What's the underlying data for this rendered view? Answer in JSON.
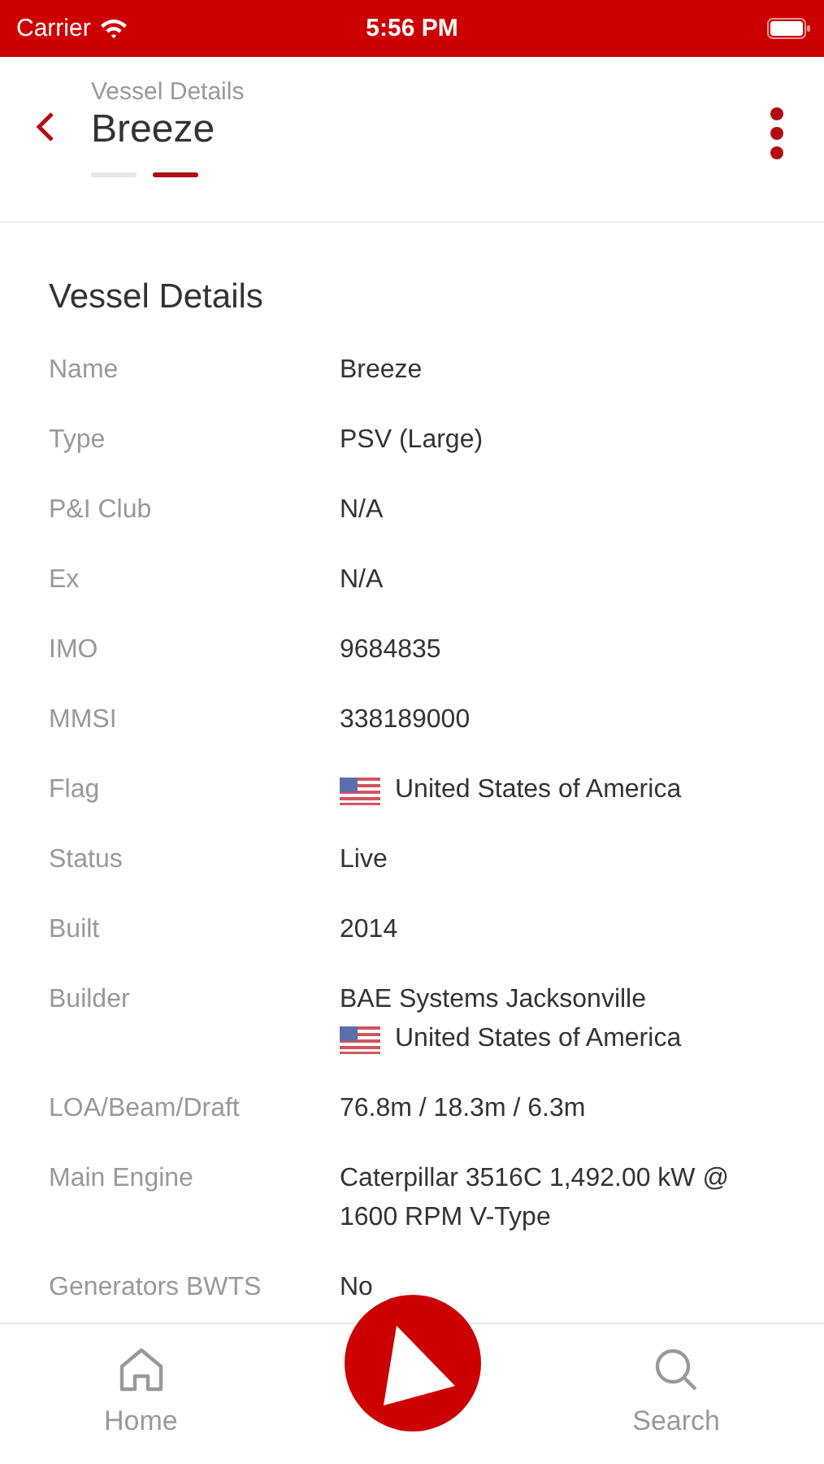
{
  "status_bar": {
    "carrier": "Carrier",
    "time": "5:56 PM"
  },
  "header": {
    "subtitle": "Vessel Details",
    "title": "Breeze",
    "pages": [
      {
        "selected": false
      },
      {
        "selected": true
      }
    ]
  },
  "section": {
    "title": "Vessel Details",
    "rows": [
      {
        "label": "Name",
        "lines": [
          {
            "text": "Breeze"
          }
        ]
      },
      {
        "label": "Type",
        "lines": [
          {
            "text": "PSV (Large)"
          }
        ]
      },
      {
        "label": "P&I Club",
        "lines": [
          {
            "text": "N/A"
          }
        ]
      },
      {
        "label": "Ex",
        "lines": [
          {
            "text": "N/A"
          }
        ]
      },
      {
        "label": "IMO",
        "lines": [
          {
            "text": "9684835"
          }
        ]
      },
      {
        "label": "MMSI",
        "lines": [
          {
            "text": "338189000"
          }
        ]
      },
      {
        "label": "Flag",
        "lines": [
          {
            "text": "United States of America",
            "flag": true
          }
        ]
      },
      {
        "label": "Status",
        "lines": [
          {
            "text": "Live"
          }
        ]
      },
      {
        "label": "Built",
        "lines": [
          {
            "text": "2014"
          }
        ]
      },
      {
        "label": "Builder",
        "lines": [
          {
            "text": "BAE Systems Jacksonville"
          },
          {
            "text": "United States of America",
            "flag": true
          }
        ]
      },
      {
        "label": "LOA/Beam/Draft",
        "lines": [
          {
            "text": "76.8m / 18.3m / 6.3m"
          }
        ]
      },
      {
        "label": "Main Engine",
        "lines": [
          {
            "text": "Caterpillar 3516C 1,492.00 kW @ 1600 RPM V-Type"
          }
        ]
      },
      {
        "label": "Generators BWTS",
        "lines": [
          {
            "text": "No"
          }
        ]
      }
    ]
  },
  "tab_bar": [
    {
      "kind": "home",
      "label": "Home"
    },
    {
      "kind": "center"
    },
    {
      "kind": "search",
      "label": "Search"
    }
  ]
}
